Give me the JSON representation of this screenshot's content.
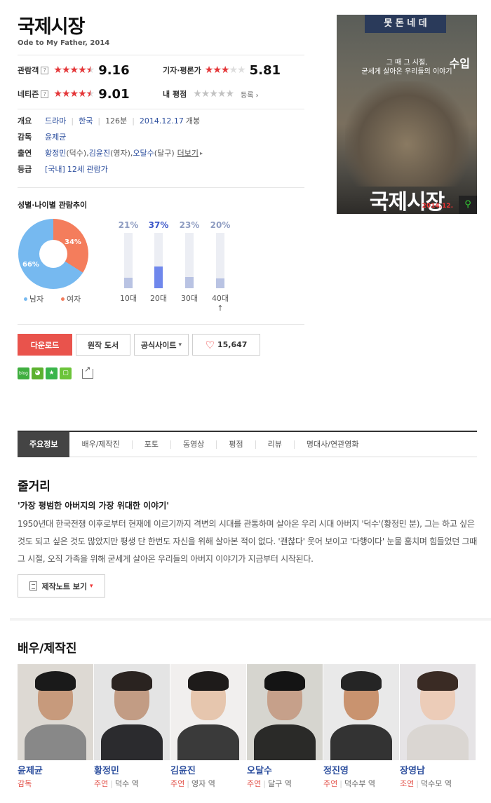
{
  "movie": {
    "title": "국제시장",
    "subtitle": "Ode to My Father, 2014"
  },
  "ratings": {
    "audience": {
      "label": "관람객",
      "help": "?",
      "score": "9.16",
      "stars": 4.5
    },
    "critic": {
      "label": "기자·평론가",
      "score": "5.81",
      "stars": 3
    },
    "netizen": {
      "label": "네티즌",
      "help": "?",
      "score": "9.01",
      "stars": 4.5
    },
    "mine": {
      "label": "내 평점",
      "register": "등록",
      "register_arrow": "›"
    }
  },
  "info": {
    "overview_label": "개요",
    "genre": "드라마",
    "country": "한국",
    "runtime": "126분",
    "release": "2014.12.17",
    "release_suffix": "개봉",
    "director_label": "감독",
    "director": "윤제균",
    "cast_label": "출연",
    "cast1": "황정민",
    "cast1_role": "(덕수), ",
    "cast2": "김윤진",
    "cast2_role": "(영자), ",
    "cast3": "오달수",
    "cast3_role": "(달구)",
    "more": "더보기",
    "more_arrow": "▸",
    "grade_label": "등급",
    "grade_prefix": "[국내]",
    "grade": "12세 관람가"
  },
  "poster": {
    "sign": "못 돈 네 데",
    "tagline_1": "그 때 그 시절,",
    "tagline_2": "굳세게 살아온 우리들의 이야기",
    "income": "수입",
    "title": "국제시장",
    "date": "2014.12.",
    "zoom_icon": "⚲"
  },
  "demographics": {
    "title": "성별·나이별 관람추이",
    "gender": [
      {
        "label": "남자",
        "pct": 66,
        "pct_text": "66%",
        "color": "#76b9f0"
      },
      {
        "label": "여자",
        "pct": 34,
        "pct_text": "34%",
        "color": "#f47d5c"
      }
    ],
    "ages": [
      {
        "label": "10대",
        "pct": 21,
        "pct_text": "21%"
      },
      {
        "label": "20대",
        "pct": 37,
        "pct_text": "37%"
      },
      {
        "label": "30대",
        "pct": 23,
        "pct_text": "23%"
      },
      {
        "label": "40대↑",
        "pct": 20,
        "pct_text": "20%"
      }
    ]
  },
  "actions": {
    "download": "다운로드",
    "book": "원작 도서",
    "official": "공식사이트",
    "official_caret": "▾",
    "like_count": "15,647"
  },
  "share": {
    "icons": [
      "blog-share-icon",
      "cafe-share-icon",
      "bookmark-share-icon",
      "memo-share-icon",
      "share-out-icon"
    ],
    "blog_text": "blog"
  },
  "tabs": [
    "주요정보",
    "배우/제작진",
    "포토",
    "동영상",
    "평점",
    "리뷰",
    "명대사/연관영화"
  ],
  "synopsis": {
    "heading": "줄거리",
    "headline": "'가장 평범한 아버지의 가장 위대한 이야기'",
    "body": "1950년대 한국전쟁 이후로부터 현재에 이르기까지 격변의 시대를 관통하며 살아온 우리 시대 아버지 '덕수'(황정민 분), 그는 하고 싶은 것도 되고 싶은 것도 많았지만 평생 단 한번도 자신을 위해 살아본 적이 없다. '괜찮다' 웃어 보이고 '다행이다' 눈물 훔치며 힘들었던 그때 그 시절, 오직 가족을 위해 굳세게 살아온 우리들의 아버지 이야기가 지금부터 시작된다.",
    "note_button": "제작노트 보기",
    "note_caret": "▾"
  },
  "cast_section": {
    "heading": "배우/제작진",
    "people": [
      {
        "name": "윤제균",
        "type": "감독",
        "char": ""
      },
      {
        "name": "황정민",
        "type": "주연",
        "char": "덕수 역"
      },
      {
        "name": "김윤진",
        "type": "주연",
        "char": "영자 역"
      },
      {
        "name": "오달수",
        "type": "주연",
        "char": "달구 역"
      },
      {
        "name": "정진영",
        "type": "주연",
        "char": "덕수부 역"
      },
      {
        "name": "장영남",
        "type": "조연",
        "char": "덕수모 역"
      }
    ]
  },
  "colors": {
    "accent_red": "#e9534c",
    "star_red": "#e43638",
    "link_blue": "#2d4f9e",
    "male_blue": "#76b9f0",
    "female_orange": "#f47d5c",
    "age_highlight": "#6f87ec"
  }
}
